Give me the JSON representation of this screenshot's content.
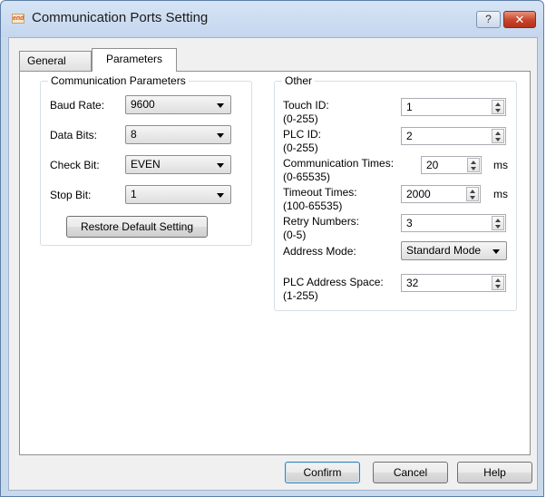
{
  "window": {
    "title": "Communication Ports Setting",
    "app_icon_text": "end",
    "help_glyph": "?",
    "close_glyph": "✕"
  },
  "tabs": [
    {
      "label": "General",
      "selected": false
    },
    {
      "label": "Parameters",
      "selected": true
    }
  ],
  "comm_params": {
    "title": "Communication Parameters",
    "baud_rate": {
      "label": "Baud Rate:",
      "value": "9600"
    },
    "data_bits": {
      "label": "Data Bits:",
      "value": "8"
    },
    "check_bit": {
      "label": "Check Bit:",
      "value": "EVEN"
    },
    "stop_bit": {
      "label": "Stop Bit:",
      "value": "1"
    },
    "restore_label": "Restore Default Setting"
  },
  "other": {
    "title": "Other",
    "touch_id": {
      "label": "Touch ID:",
      "range": "(0-255)",
      "value": "1"
    },
    "plc_id": {
      "label": "PLC ID:",
      "range": "(0-255)",
      "value": "2"
    },
    "comm_times": {
      "label": "Communication Times:",
      "range": "(0-65535)",
      "value": "20",
      "unit": "ms"
    },
    "timeout_times": {
      "label": "Timeout Times:",
      "range": "(100-65535)",
      "value": "2000",
      "unit": "ms"
    },
    "retry_numbers": {
      "label": "Retry Numbers:",
      "range": "(0-5)",
      "value": "3"
    },
    "address_mode": {
      "label": "Address Mode:",
      "value": "Standard Mode"
    },
    "plc_address_space": {
      "label": "PLC Address Space:",
      "range": "(1-255)",
      "value": "32"
    }
  },
  "footer": {
    "confirm_label": "Confirm",
    "cancel_label": "Cancel",
    "help_label": "Help"
  },
  "colors": {
    "title_bar": "#c4d6ee",
    "close_button": "#c7432a",
    "default_button_border": "#3c7fb1"
  }
}
